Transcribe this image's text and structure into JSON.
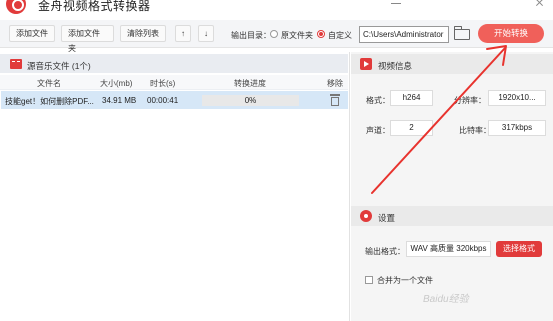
{
  "window": {
    "title": "金舟视频格式转换器"
  },
  "toolbar": {
    "add_file": "添加文件",
    "add_folder": "添加文件夹",
    "clear_list": "清除列表",
    "move_up": "↑",
    "move_down": "↓",
    "output_dir_label": "输出目录：",
    "radio_source_folder": "原文件夹",
    "radio_custom": "自定义",
    "output_path": "C:\\Users\\Administrator",
    "start_convert": "开始转换"
  },
  "file_panel": {
    "title": "源音乐文件 (1个)",
    "columns": [
      "文件名",
      "大小(mb)",
      "时长(s)",
      "转换进度",
      "移除"
    ],
    "rows": [
      {
        "name": "技能get！如何删除PDF...",
        "size": "34.91 MB",
        "duration": "00:00:41",
        "progress_text": "0%",
        "progress": 0
      }
    ]
  },
  "video_info": {
    "title": "视频信息",
    "format_label": "格式：",
    "format_value": "h264",
    "resolution_label": "分辨率：",
    "resolution_value": "1920x10...",
    "channels_label": "声道：",
    "channels_value": "2",
    "bitrate_label": "比特率：",
    "bitrate_value": "317kbps"
  },
  "settings": {
    "title": "设置",
    "output_format_label": "输出格式：",
    "output_format_value": "WAV 高质量 320kbps",
    "select_format": "选择格式",
    "merge_label": "合并为一个文件"
  },
  "watermark": "Baidu经验",
  "colors": {
    "accent": "#e13b3b",
    "start_button": "#f0605a",
    "selected_row": "#d6e7f7",
    "annotation_arrow": "#e8332e"
  }
}
